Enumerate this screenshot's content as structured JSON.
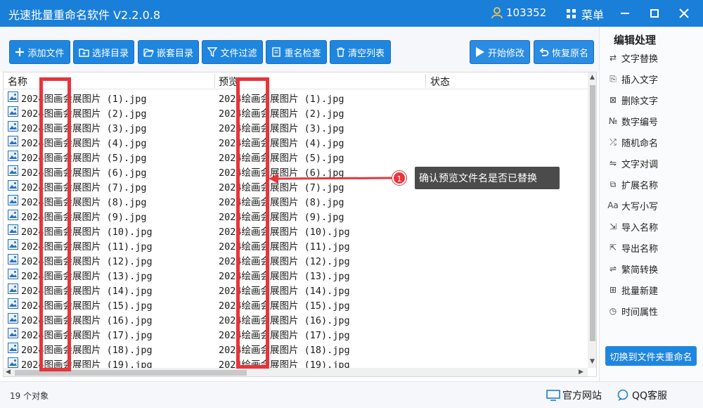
{
  "app": {
    "title": "光速批量重命名软件 V2.2.0.8",
    "user_id": "103352",
    "menu_label": "菜单"
  },
  "toolbar": {
    "add_file": "添加文件",
    "select_dir": "选择目录",
    "nested_dir": "嵌套目录",
    "file_filter": "文件过滤",
    "rename_check": "重名检查",
    "clear_list": "清空列表",
    "start_modify": "开始修改",
    "restore_names": "恢复原名"
  },
  "columns": {
    "name": "名称",
    "preview": "预览",
    "status": "状态"
  },
  "rows": [
    {
      "name": "2024图画会展图片 (1).jpg",
      "preview": "2024绘画会展图片 (1).jpg"
    },
    {
      "name": "2024图画会展图片 (2).jpg",
      "preview": "2024绘画会展图片 (2).jpg"
    },
    {
      "name": "2024图画会展图片 (3).jpg",
      "preview": "2024绘画会展图片 (3).jpg"
    },
    {
      "name": "2024图画会展图片 (4).jpg",
      "preview": "2024绘画会展图片 (4).jpg"
    },
    {
      "name": "2024图画会展图片 (5).jpg",
      "preview": "2024绘画会展图片 (5).jpg"
    },
    {
      "name": "2024图画会展图片 (6).jpg",
      "preview": "2024绘画会展图片 (6).jpg"
    },
    {
      "name": "2024图画会展图片 (7).jpg",
      "preview": "2024绘画会展图片 (7).jpg"
    },
    {
      "name": "2024图画会展图片 (8).jpg",
      "preview": "2024绘画会展图片 (8).jpg"
    },
    {
      "name": "2024图画会展图片 (9).jpg",
      "preview": "2024绘画会展图片 (9).jpg"
    },
    {
      "name": "2024图画会展图片 (10).jpg",
      "preview": "2024绘画会展图片 (10).jpg"
    },
    {
      "name": "2024图画会展图片 (11).jpg",
      "preview": "2024绘画会展图片 (11).jpg"
    },
    {
      "name": "2024图画会展图片 (12).jpg",
      "preview": "2024绘画会展图片 (12).jpg"
    },
    {
      "name": "2024图画会展图片 (13).jpg",
      "preview": "2024绘画会展图片 (13).jpg"
    },
    {
      "name": "2024图画会展图片 (14).jpg",
      "preview": "2024绘画会展图片 (14).jpg"
    },
    {
      "name": "2024图画会展图片 (15).jpg",
      "preview": "2024绘画会展图片 (15).jpg"
    },
    {
      "name": "2024图画会展图片 (16).jpg",
      "preview": "2024绘画会展图片 (16).jpg"
    },
    {
      "name": "2024图画会展图片 (17).jpg",
      "preview": "2024绘画会展图片 (17).jpg"
    },
    {
      "name": "2024图画会展图片 (18).jpg",
      "preview": "2024绘画会展图片 (18).jpg"
    },
    {
      "name": "2024图画会展图片 (19).jpg",
      "preview": "2024绘画会展图片 (19).jpg"
    }
  ],
  "annotation": {
    "number": "1",
    "text": "确认预览文件名是否已替换"
  },
  "right_panel": {
    "title": "编辑处理",
    "items": [
      {
        "label": "文字替换",
        "icon": "replace-icon"
      },
      {
        "label": "插入文字",
        "icon": "insert-icon"
      },
      {
        "label": "删除文字",
        "icon": "delete-text-icon"
      },
      {
        "label": "数字编号",
        "icon": "number-icon"
      },
      {
        "label": "随机命名",
        "icon": "shuffle-icon"
      },
      {
        "label": "文字对调",
        "icon": "swap-icon"
      },
      {
        "label": "扩展名称",
        "icon": "extension-icon"
      },
      {
        "label": "大写小写",
        "icon": "case-icon"
      },
      {
        "label": "导入名称",
        "icon": "import-icon"
      },
      {
        "label": "导出名称",
        "icon": "export-icon"
      },
      {
        "label": "繁简转换",
        "icon": "convert-icon"
      },
      {
        "label": "批量新建",
        "icon": "batch-new-icon"
      },
      {
        "label": "时间属性",
        "icon": "clock-icon"
      }
    ],
    "switch_button": "切换到文件夹重命名"
  },
  "status": {
    "count_text": "19 个对象",
    "website_label": "官方网站",
    "qq_label": "QQ客服"
  },
  "colors": {
    "titlebar": "#1a7fd8",
    "button": "#1f86e0",
    "highlight": "#e8343a",
    "callout": "#4b4b4b"
  }
}
